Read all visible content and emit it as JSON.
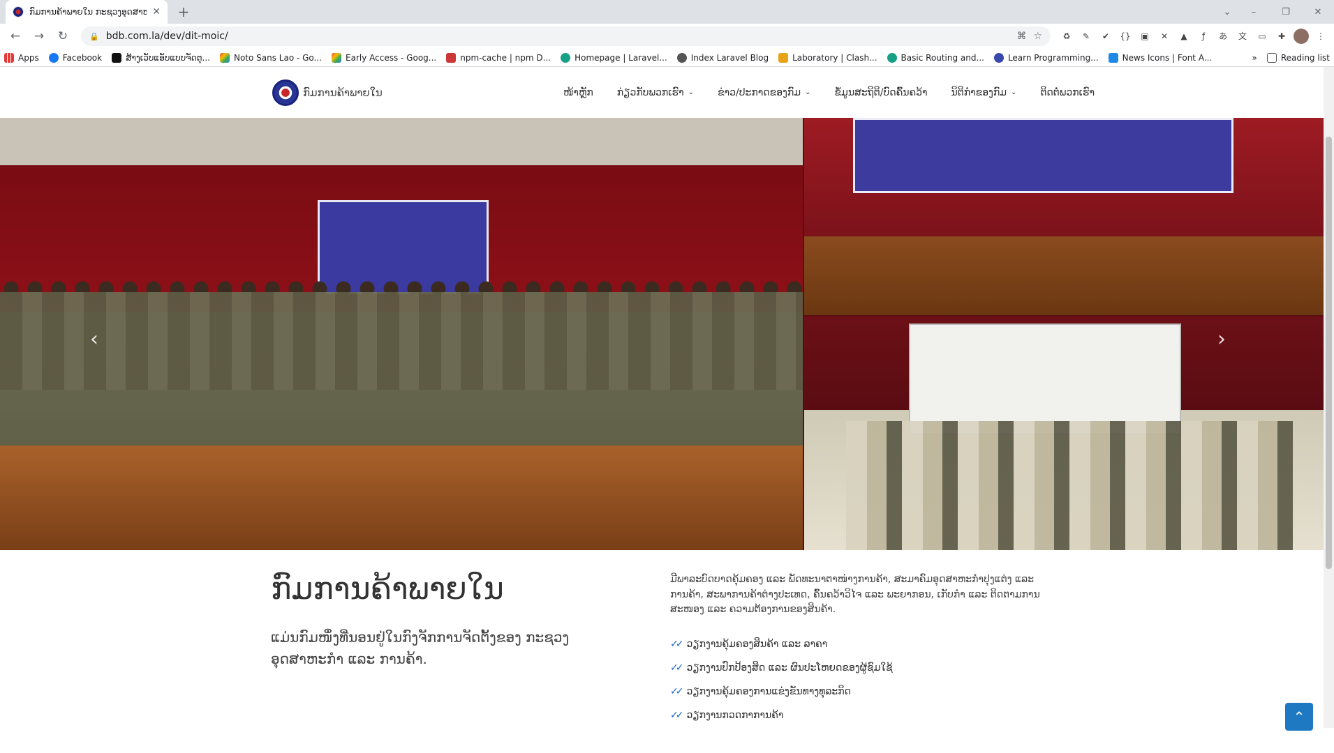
{
  "browser": {
    "tab_title": "ກົມການຄ້າພາຍໃນ ກະຊວງອຸດສາຫະກຳ",
    "tab_close": "✕",
    "new_tab": "+",
    "url": "bdb.com.la/dev/dit-moic/",
    "window_controls": [
      "–",
      "❐",
      "✕"
    ]
  },
  "bookmarks": {
    "apps": "Apps",
    "items": [
      "Facebook",
      "ສ້າງເວັບແອັບແບບຈັດຕຸ...",
      "Noto Sans Lao - Go...",
      "Early Access - Goog...",
      "npm-cache | npm D...",
      "Homepage | Laravel...",
      "Index Laravel Blog",
      "Laboratory | Clash...",
      "Basic Routing and...",
      "Learn Programming...",
      "News Icons | Font A..."
    ],
    "more": "»",
    "reading_list": "Reading list"
  },
  "site": {
    "logo_text": "ກົມການຄ້າພາຍໃນ",
    "menu": [
      {
        "label": "ໜ້າຫຼັກ",
        "dropdown": false
      },
      {
        "label": "ກ່ຽວກັບພວກເຮົາ",
        "dropdown": true
      },
      {
        "label": "ຂ່າວ/ປະກາດຂອງກົມ",
        "dropdown": true
      },
      {
        "label": "ຂໍ້ມູນສະຖິຕິ/ບົດຄົ້ນຄວ້າ",
        "dropdown": false
      },
      {
        "label": "ນິຕິກຳຂອງກົມ",
        "dropdown": true
      },
      {
        "label": "ຕິດຕໍ່ພວກເຮົາ",
        "dropdown": false
      }
    ],
    "chevron": "⌄"
  },
  "hero": {
    "arrow_prev": "‹",
    "arrow_next": "›"
  },
  "intro": {
    "title": "ກົມການຄ້າພາຍໃນ",
    "subtitle": "ແມ່ນກົມໜຶ່ງທີ່ນອນຢູ່ໃນກົງຈັກການຈັດຕັ້ງຂອງ ກະຊວງອຸດສາຫະກຳ ແລະ ການຄ້າ.",
    "description": "ມີພາລະບົດບາດຄຸ້ມຄອງ ແລະ ພັດທະນາຕາໜ່າງການຄ້າ, ສະມາຄົມອຸດສາຫະກຳປຸງແຕ່ງ ແລະ ການຄ້າ, ສະພາການຄ້າຕ່າງປະເທດ, ຄົ້ນຄວ້າວິໄຈ ແລະ ພະຍາກອນ, ເກັບກຳ ແລະ ຕິດຕາມການສະໜອງ ແລະ ຄວາມຕ້ອງການຂອງສິນຄ້າ.",
    "bullets": [
      "ວຽກງານຄຸ້ມຄອງສິນຄ້າ ແລະ ລາຄາ",
      "ວຽກງານປົກປ້ອງສິດ ແລະ ຜົນປະໂຫຍດຂອງຜູ້ຊົມໃຊ້",
      "ວຽກງານຄຸ້ມຄອງການແຂ່ງຂັນທາງທຸລະກິດ",
      "ວຽກງານກວດກາການຄ້າ"
    ],
    "check_glyph": "✓✓"
  },
  "back_to_top": "⌃",
  "colors": {
    "accent_blue": "#1e78c2",
    "banner_blue": "#3d3b9e",
    "curtain_red": "#8e1018"
  }
}
